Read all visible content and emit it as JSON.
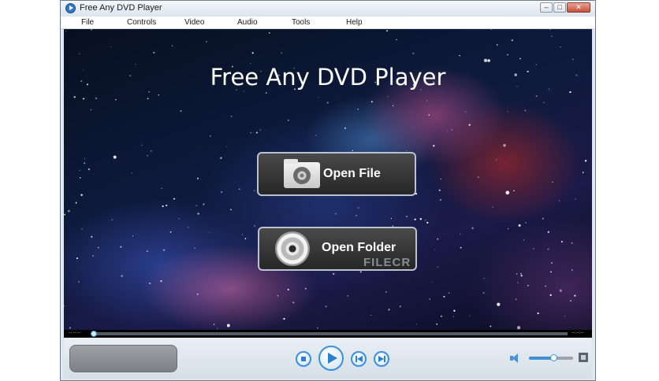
{
  "window": {
    "title": "Free Any DVD Player",
    "controls": {
      "minimize": "–",
      "maximize": "□",
      "close": "✕"
    }
  },
  "menu": [
    "File",
    "Controls",
    "Video",
    "Audio",
    "Tools",
    "Help"
  ],
  "stage": {
    "heading": "Free Any DVD Player",
    "open_file_label": "Open File",
    "open_folder_label": "Open Folder",
    "watermark": "FILECR"
  },
  "seekbar": {
    "elapsed": "--:--:--",
    "total": "--:--:--",
    "progress": 0
  },
  "volume": {
    "level": 0.55
  },
  "icons": {
    "app": "play-circle-icon",
    "open_file": "film-folder-icon",
    "open_folder": "disc-icon",
    "stop": "stop-icon",
    "play": "play-icon",
    "previous": "skip-previous-icon",
    "next": "skip-next-icon",
    "volume": "speaker-icon",
    "fullscreen": "fullscreen-icon"
  },
  "colors": {
    "accent": "#3a8fe0",
    "button_dark": "#2b2b2b",
    "control_bar": "#dfe7ef"
  }
}
